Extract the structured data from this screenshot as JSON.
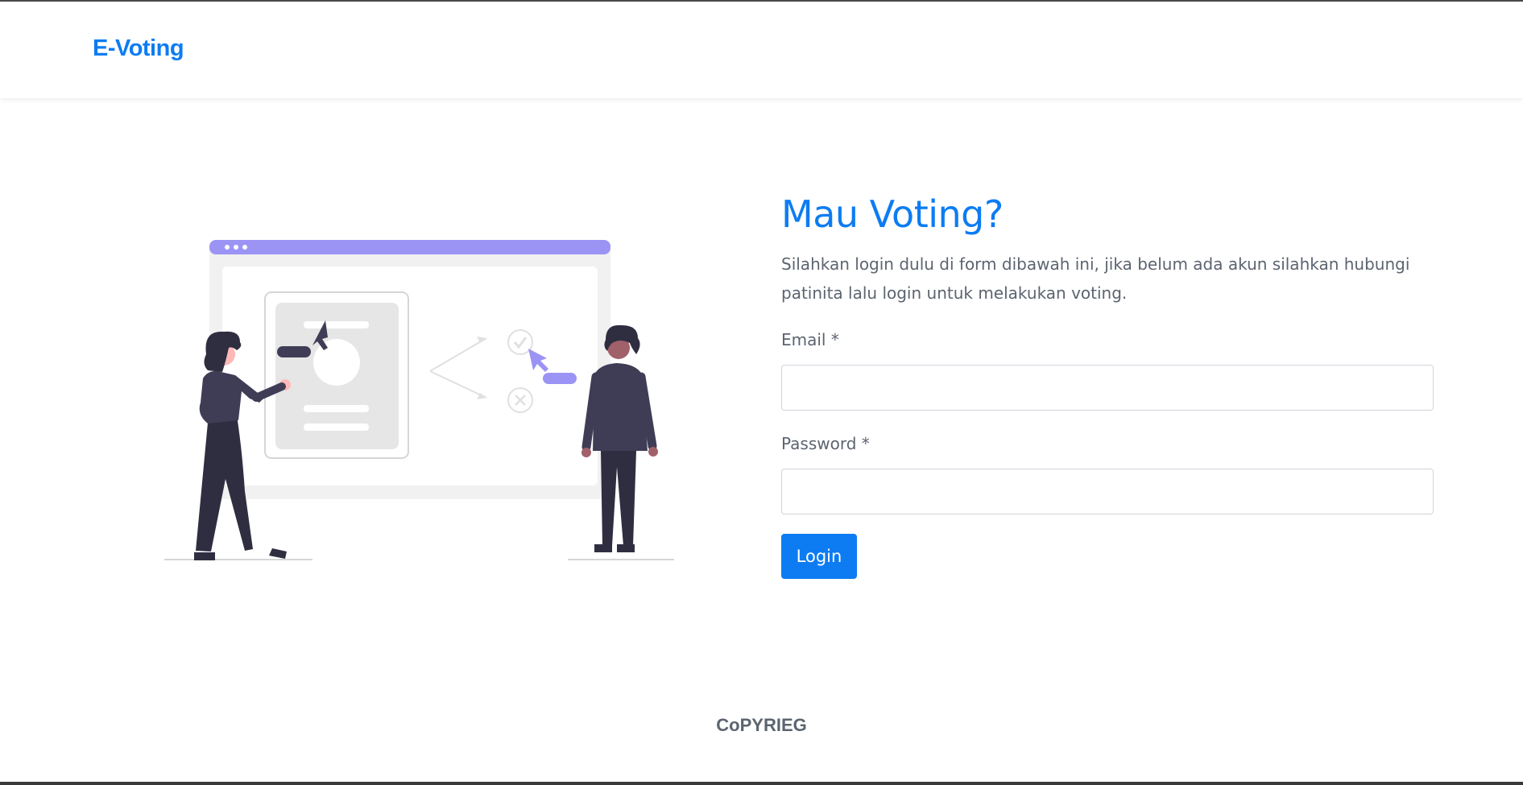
{
  "navbar": {
    "brand": "E-Voting"
  },
  "hero": {
    "title": "Mau Voting?",
    "description": "Silahkan login dulu di form dibawah ini, jika belum ada akun silahkan hubungi patinita lalu login untuk melakukan voting."
  },
  "form": {
    "email_label": "Email *",
    "email_value": "",
    "password_label": "Password *",
    "password_value": "",
    "login_label": "Login"
  },
  "footer": {
    "text": "CoPYRIEG"
  },
  "colors": {
    "accent": "#0d7cf2",
    "text_muted": "#5c6470",
    "illustration_purple": "#9b94f5",
    "illustration_dark": "#3f3d56"
  }
}
